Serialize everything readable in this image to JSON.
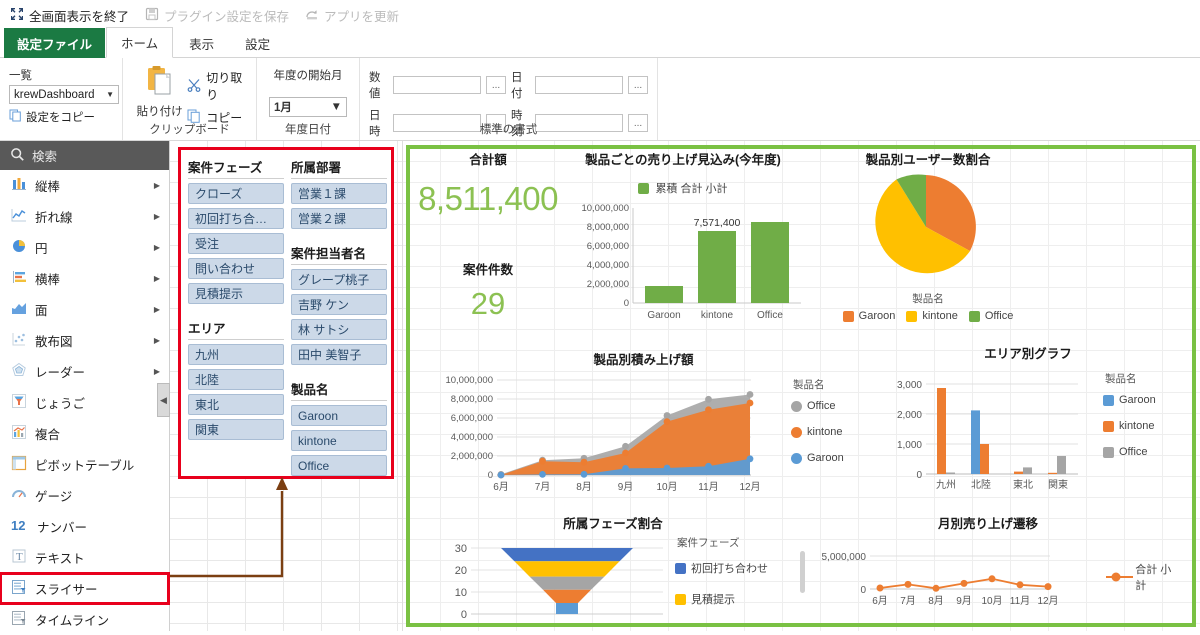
{
  "topbar": {
    "commands": [
      {
        "label": "全画面表示を終了",
        "icon": "fullscreen-exit-icon",
        "enabled": true
      },
      {
        "label": "プラグイン設定を保存",
        "icon": "save-icon",
        "enabled": false
      },
      {
        "label": "アプリを更新",
        "icon": "refresh-app-icon",
        "enabled": false
      }
    ]
  },
  "tabs": [
    {
      "label": "設定ファイル",
      "kind": "file"
    },
    {
      "label": "ホーム",
      "kind": "active"
    },
    {
      "label": "表示",
      "kind": "normal"
    },
    {
      "label": "設定",
      "kind": "normal"
    }
  ],
  "ribbon": {
    "list_group": {
      "field_label": "一覧",
      "combo_value": "krewDashboard",
      "copy_settings": "設定をコピー"
    },
    "clipboard_group": {
      "group_label": "クリップボード",
      "paste": "貼り付け",
      "cut": "切り取り",
      "copy": "コピー"
    },
    "fiscal_group": {
      "group_label": "年度日付",
      "start_month_label": "年度の開始月",
      "start_month_value": "1月"
    },
    "format_group": {
      "group_label": "標準の書式",
      "rows": [
        {
          "l1": "数値",
          "v1": "",
          "l2": "日付",
          "v2": ""
        },
        {
          "l1": "日時",
          "v1": "",
          "l2": "時刻",
          "v2": ""
        }
      ],
      "ellipsis": "..."
    }
  },
  "palette": {
    "search_placeholder": "検索",
    "items": [
      {
        "label": "縦棒",
        "icon": "column-chart-icon",
        "submenu": true
      },
      {
        "label": "折れ線",
        "icon": "line-chart-icon",
        "submenu": true
      },
      {
        "label": "円",
        "icon": "pie-chart-icon",
        "submenu": true
      },
      {
        "label": "横棒",
        "icon": "bar-chart-icon",
        "submenu": true
      },
      {
        "label": "面",
        "icon": "area-chart-icon",
        "submenu": true
      },
      {
        "label": "散布図",
        "icon": "scatter-chart-icon",
        "submenu": true
      },
      {
        "label": "レーダー",
        "icon": "radar-chart-icon",
        "submenu": true
      },
      {
        "label": "じょうご",
        "icon": "funnel-chart-icon",
        "submenu": false
      },
      {
        "label": "複合",
        "icon": "combo-chart-icon",
        "submenu": false
      },
      {
        "label": "ピボットテーブル",
        "icon": "pivot-table-icon",
        "submenu": false
      },
      {
        "label": "ゲージ",
        "icon": "gauge-icon",
        "submenu": false
      },
      {
        "label": "ナンバー",
        "icon": "number-icon",
        "submenu": false
      },
      {
        "label": "テキスト",
        "icon": "text-icon",
        "submenu": false
      },
      {
        "label": "スライサー",
        "icon": "slicer-icon",
        "submenu": false,
        "highlight": true
      },
      {
        "label": "タイムライン",
        "icon": "timeline-icon",
        "submenu": false
      }
    ]
  },
  "slicers": {
    "left": [
      {
        "title": "案件フェーズ",
        "items": [
          "クローズ",
          "初回打ち合…",
          "受注",
          "問い合わせ",
          "見積提示"
        ]
      },
      {
        "title": "エリア",
        "items": [
          "九州",
          "北陸",
          "東北",
          "関東"
        ]
      }
    ],
    "right": [
      {
        "title": "所属部署",
        "items": [
          "営業１課",
          "営業２課"
        ]
      },
      {
        "title": "案件担当者名",
        "items": [
          "グレープ桃子",
          "吉野 ケン",
          "林 サトシ",
          "田中 美智子"
        ]
      },
      {
        "title": "製品名",
        "items": [
          "Garoon",
          "kintone",
          "Office"
        ]
      }
    ]
  },
  "dashboard": {
    "kpi_total": {
      "label": "合計額",
      "value": "8,511,400"
    },
    "kpi_count": {
      "label": "案件件数",
      "value": "29"
    }
  },
  "chart_data": [
    {
      "id": "product-forecast-bar",
      "type": "bar",
      "title": "製品ごとの売り上げ見込み(今年度)",
      "legend": [
        "累積 合計 小計"
      ],
      "legend_position": "top",
      "categories": [
        "Garoon",
        "kintone",
        "Office"
      ],
      "values": [
        1800000,
        7571400,
        8511400
      ],
      "data_labels": {
        "kintone": "7,571,400"
      },
      "ytick_labels": [
        "0",
        "2,000,000",
        "4,000,000",
        "6,000,000",
        "8,000,000",
        "10,000,000"
      ],
      "ylim": [
        0,
        10000000
      ],
      "color": "#70ad47",
      "xlabel": "",
      "ylabel": ""
    },
    {
      "id": "product-user-pie",
      "type": "pie",
      "title": "製品別ユーザー数割合",
      "legend_title": "製品名",
      "labels": [
        "Garoon",
        "kintone",
        "Office"
      ],
      "values": [
        27,
        62,
        11
      ],
      "colors": [
        "#ed7d31",
        "#ffc000",
        "#70ad47"
      ],
      "legend_position": "bottom"
    },
    {
      "id": "product-stacked-area",
      "type": "area",
      "title": "製品別積み上げ額",
      "legend_title": "製品名",
      "x": [
        "6月",
        "7月",
        "8月",
        "9月",
        "10月",
        "11月",
        "12月"
      ],
      "series": [
        {
          "name": "Garoon",
          "values": [
            0,
            60000,
            70000,
            700000,
            740000,
            920000,
            1700000
          ],
          "color": "#5b9bd5"
        },
        {
          "name": "kintone",
          "values": [
            0,
            1250000,
            1280000,
            1550000,
            4900000,
            5900000,
            5880000
          ],
          "color": "#ed7d31"
        },
        {
          "name": "Office",
          "values": [
            60000,
            100000,
            120000,
            700000,
            700000,
            1000000,
            900000
          ],
          "color": "#a5a5a5"
        }
      ],
      "ytick_labels": [
        "0",
        "2,000,000",
        "4,000,000",
        "6,000,000",
        "8,000,000",
        "10,000,000"
      ],
      "ylim": [
        0,
        10000000
      ],
      "legend_position": "right"
    },
    {
      "id": "area-bar",
      "type": "bar",
      "title": "エリア別グラフ",
      "legend_title": "製品名",
      "categories": [
        "九州",
        "北陸",
        "東北",
        "関東"
      ],
      "series": [
        {
          "name": "Garoon",
          "values": [
            0,
            2120,
            0,
            0
          ],
          "color": "#5b9bd5"
        },
        {
          "name": "kintone",
          "values": [
            2880,
            1000,
            80,
            40
          ],
          "color": "#ed7d31"
        },
        {
          "name": "Office",
          "values": [
            50,
            0,
            220,
            600
          ],
          "color": "#a5a5a5"
        }
      ],
      "ytick_labels": [
        "0",
        "1,000",
        "2,000",
        "3,000"
      ],
      "ylim": [
        0,
        3000
      ],
      "legend_position": "right"
    },
    {
      "id": "phase-funnel",
      "type": "funnel",
      "title": "所属フェーズ割合",
      "legend_title": "案件フェーズ",
      "ytick_labels": [
        "0",
        "10",
        "20",
        "30"
      ],
      "ylim": [
        0,
        30
      ],
      "stages": [
        {
          "name": "初回打ち合わせ",
          "from": 30,
          "to": 24,
          "color": "#4472c4"
        },
        {
          "name": "見積提示",
          "from": 24,
          "to": 17,
          "color": "#ffc000"
        },
        {
          "name": "",
          "from": 17,
          "to": 11,
          "color": "#a5a5a5"
        },
        {
          "name": "",
          "from": 11,
          "to": 5,
          "color": "#ed7d31"
        },
        {
          "name": "",
          "from": 5,
          "to": 0,
          "color": "#5b9bd5"
        }
      ],
      "legend_visible": [
        "初回打ち合わせ",
        "見積提示"
      ],
      "legend_position": "right"
    },
    {
      "id": "monthly-trend-line",
      "type": "line",
      "title": "月別売り上げ遷移",
      "legend": [
        "合計 小計"
      ],
      "x": [
        "6月",
        "7月",
        "8月",
        "9月",
        "10月",
        "11月",
        "12月"
      ],
      "values": [
        160000,
        700000,
        110000,
        850000,
        1550000,
        640000,
        360000
      ],
      "ytick_labels": [
        "0",
        "5,000,000"
      ],
      "ylim": [
        0,
        5000000
      ],
      "color": "#ed7d31",
      "legend_position": "right"
    }
  ]
}
